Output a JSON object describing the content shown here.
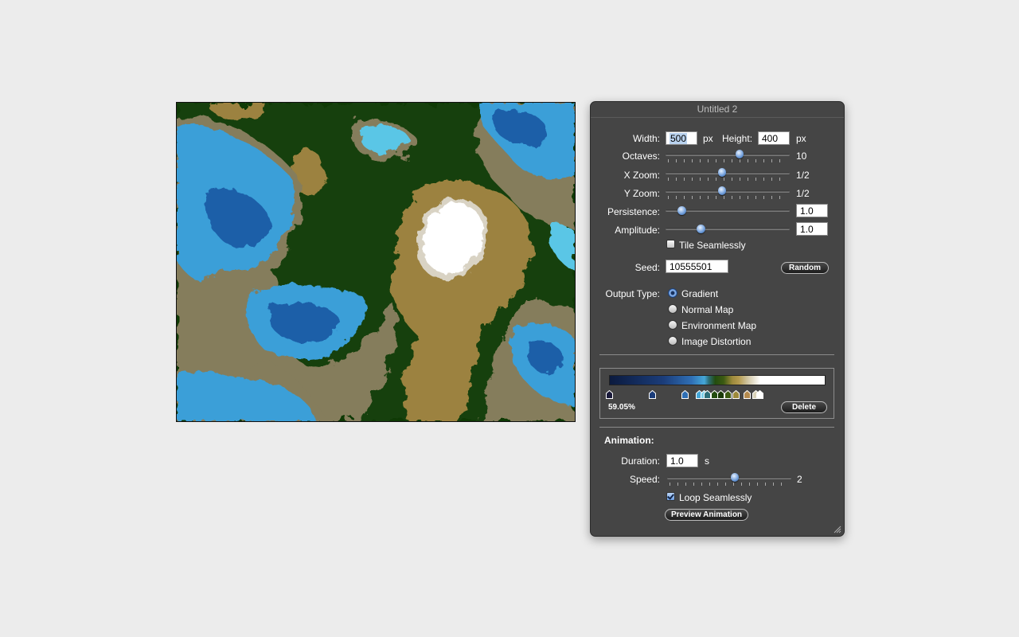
{
  "window": {
    "title": "Untitled 2"
  },
  "size": {
    "width_label": "Width:",
    "width_value": "500",
    "width_unit": "px",
    "height_label": "Height:",
    "height_value": "400",
    "height_unit": "px"
  },
  "octaves": {
    "label": "Octaves:",
    "value_text": "10",
    "level": 0.6
  },
  "x_zoom": {
    "label": "X Zoom:",
    "value_text": "1/2",
    "level": 0.45
  },
  "y_zoom": {
    "label": "Y Zoom:",
    "value_text": "1/2",
    "level": 0.45
  },
  "persistence": {
    "label": "Persistence:",
    "value": "1.0",
    "level": 0.1
  },
  "amplitude": {
    "label": "Amplitude:",
    "value": "1.0",
    "level": 0.27
  },
  "tile_seamlessly": {
    "label": "Tile Seamlessly",
    "checked": false
  },
  "seed": {
    "label": "Seed:",
    "value": "10555501",
    "random_button": "Random"
  },
  "output_type": {
    "label": "Output Type:",
    "options": [
      "Gradient",
      "Normal Map",
      "Environment Map",
      "Image Distortion"
    ],
    "selected": "Gradient"
  },
  "gradient": {
    "selected_percent": "59.05%",
    "delete_button": "Delete",
    "stops": [
      {
        "pos": 0.0,
        "color": "#1a1a3a"
      },
      {
        "pos": 0.2,
        "color": "#1b3d7a"
      },
      {
        "pos": 0.35,
        "color": "#2f6fb5"
      },
      {
        "pos": 0.42,
        "color": "#45a7d8"
      },
      {
        "pos": 0.44,
        "color": "#7fd0ea"
      },
      {
        "pos": 0.455,
        "color": "#2d6f7a"
      },
      {
        "pos": 0.49,
        "color": "#234c0f"
      },
      {
        "pos": 0.52,
        "color": "#1a3a08"
      },
      {
        "pos": 0.55,
        "color": "#3c5a12"
      },
      {
        "pos": 0.5905,
        "color": "#9d8a3c"
      },
      {
        "pos": 0.64,
        "color": "#b48a4e"
      },
      {
        "pos": 0.68,
        "color": "#d9d2b8"
      },
      {
        "pos": 0.7,
        "color": "#ffffff"
      }
    ]
  },
  "animation": {
    "heading": "Animation:",
    "duration_label": "Duration:",
    "duration_value": "1.0",
    "duration_unit": "s",
    "speed_label": "Speed:",
    "speed_value_text": "2",
    "speed_level": 0.55,
    "loop_label": "Loop Seamlessly",
    "loop_checked": true,
    "preview_button": "Preview Animation"
  },
  "colors": {
    "deep_water": "#1a58a6",
    "shallow_water": "#5cc6e8",
    "lowland": "#0f3a05",
    "shore": "#8c8462",
    "highland": "#a8863e",
    "snow": "#ffffff"
  }
}
